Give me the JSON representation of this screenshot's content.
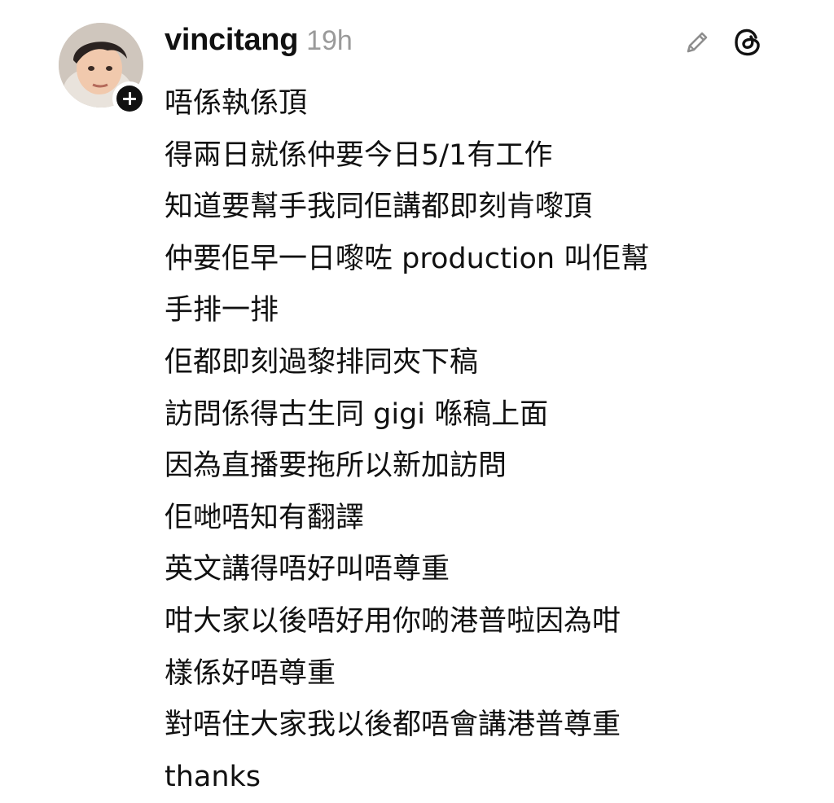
{
  "post": {
    "username": "vincitang",
    "timestamp": "19h",
    "lines": [
      "唔係執係頂",
      "得兩日就係仲要今日5/1有工作",
      "知道要幫手我同佢講都即刻肯嚟頂",
      "仲要佢早一日嚟咗 production 叫佢幫",
      "手排一排",
      "佢都即刻過黎排同夾下稿",
      "訪問係得古生同 gigi 喺稿上面",
      "因為直播要拖所以新加訪問",
      "佢哋唔知有翻譯",
      "英文講得唔好叫唔尊重",
      "咁大家以後唔好用你啲港普啦因為咁",
      "樣係好唔尊重",
      "對唔住大家我以後都唔會講港普尊重",
      "thanks"
    ]
  },
  "icons": {
    "edit": "pencil-icon",
    "app": "threads-icon",
    "follow": "plus-icon"
  },
  "colors": {
    "text": "#111111",
    "timestamp": "#9a9a9a",
    "icon": "#8e8e8e",
    "badge": "#111111"
  }
}
